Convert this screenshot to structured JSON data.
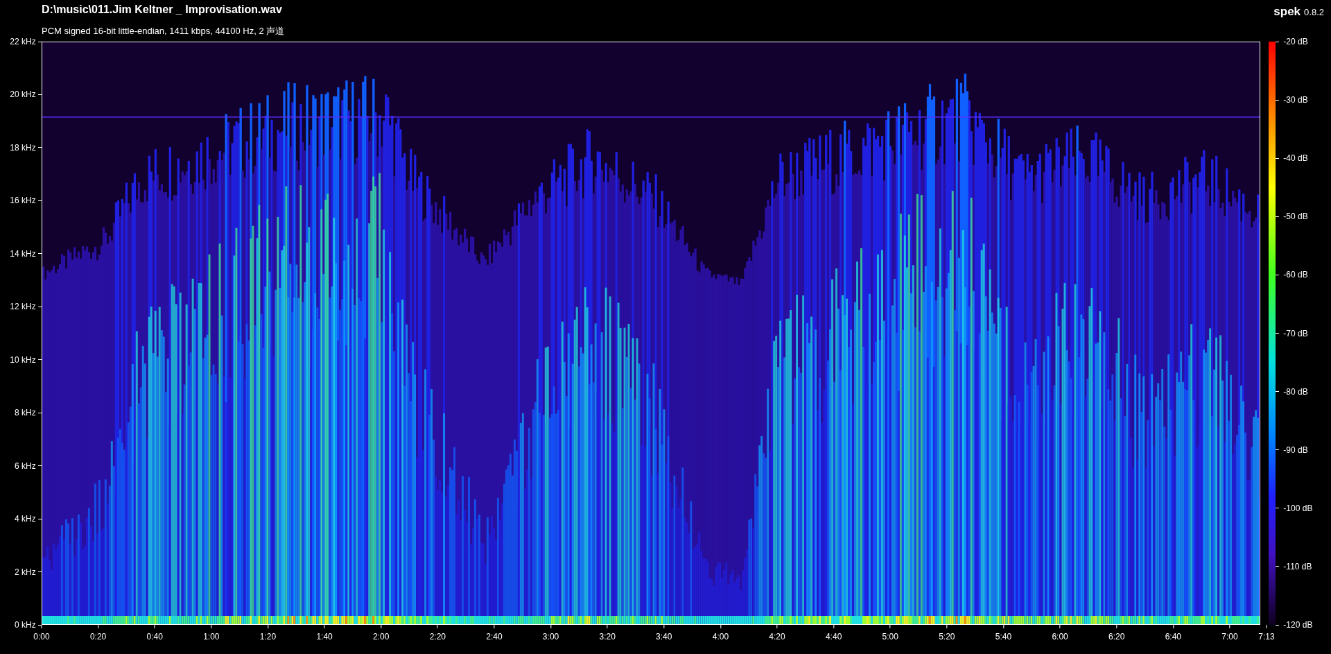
{
  "header": {
    "file_path": "D:\\music\\011.Jim Keltner _ Improvisation.wav",
    "format_info": "PCM signed 16-bit little-endian, 1411 kbps, 44100 Hz, 2 声道",
    "app_name": "spek",
    "app_version": "0.8.2"
  },
  "frequency_axis": [
    "22 kHz",
    "20 kHz",
    "18 kHz",
    "16 kHz",
    "14 kHz",
    "12 kHz",
    "10 kHz",
    "8 kHz",
    "6 kHz",
    "4 kHz",
    "2 kHz",
    "0 kHz"
  ],
  "time_axis": [
    "0:00",
    "0:20",
    "0:40",
    "1:00",
    "1:20",
    "1:40",
    "2:00",
    "2:20",
    "2:40",
    "3:00",
    "3:20",
    "3:40",
    "4:00",
    "4:20",
    "4:40",
    "5:00",
    "5:20",
    "5:40",
    "6:00",
    "6:20",
    "6:40",
    "7:00",
    "7:13"
  ],
  "level_scale": [
    "-20 dB",
    "-30 dB",
    "-40 dB",
    "-50 dB",
    "-60 dB",
    "-70 dB",
    "-80 dB",
    "-90 dB",
    "-100 dB",
    "-110 dB",
    "-120 dB"
  ]
}
